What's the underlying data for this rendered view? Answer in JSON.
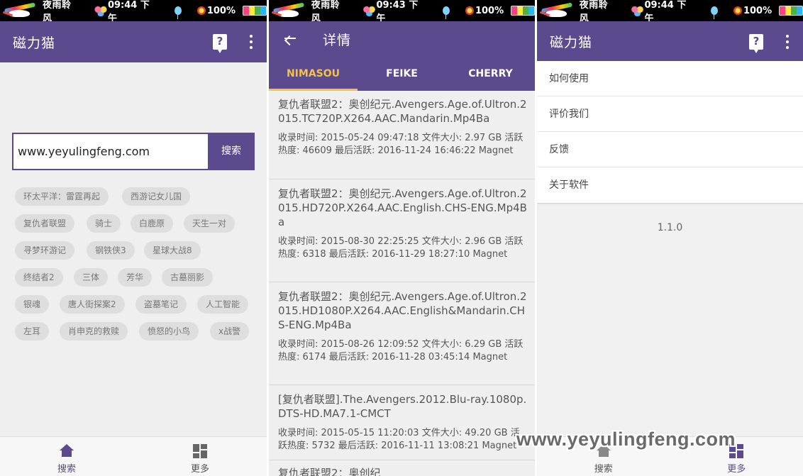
{
  "status_bars": [
    {
      "name": "夜雨聆风",
      "time": "09:44 下午",
      "battery": "100%"
    },
    {
      "name": "夜雨聆风",
      "time": "09:43 下午",
      "battery": "100%"
    },
    {
      "name": "夜雨聆风",
      "time": "09:44 下午",
      "battery": "100%"
    }
  ],
  "search_screen": {
    "title": "磁力猫",
    "input_value": "www.yeyulingfeng.com",
    "search_button": "搜索",
    "tags": [
      [
        "环太平洋：雷霆再起",
        "西游记女儿国"
      ],
      [
        "复仇者联盟",
        "骑士",
        "白鹿原",
        "天生一对"
      ],
      [
        "寻梦环游记",
        "钢铁侠3",
        "星球大战8"
      ],
      [
        "终结者2",
        "三体",
        "芳华",
        "古墓丽影"
      ],
      [
        "银魂",
        "唐人街探案2",
        "盗墓笔记",
        "人工智能"
      ],
      [
        "左耳",
        "肖申克的救赎",
        "愤怒的小鸟",
        "x战警"
      ]
    ],
    "bottom_nav": {
      "search": "搜索",
      "more": "更多"
    }
  },
  "detail_screen": {
    "title": "详情",
    "tabs": [
      "NIMASOU",
      "FEIKE",
      "CHERRY"
    ],
    "results": [
      {
        "title": "复仇者联盟2：奥创纪元.Avengers.Age.of.Ultron.2015.TC720P.X264.AAC.Mandarin.Mp4Ba",
        "meta": "收录时间: 2015-05-24 09:47:18 文件大小: 2.97 GB 活跃热度: 46609 最后活跃: 2016-11-24 16:46:22 Magnet"
      },
      {
        "title": "复仇者联盟2：奥创纪元.Avengers.Age.of.Ultron.2015.HD720P.X264.AAC.English.CHS-ENG.Mp4Ba",
        "meta": "收录时间: 2015-08-30 22:25:25 文件大小: 2.96 GB 活跃热度: 6318 最后活跃: 2016-11-29 18:27:10 Magnet"
      },
      {
        "title": "复仇者联盟2：奥创纪元.Avengers.Age.of.Ultron.2015.HD1080P.X264.AAC.English&Mandarin.CHS-ENG.Mp4Ba",
        "meta": "收录时间: 2015-08-26 12:09:52 文件大小: 6.29 GB 活跃热度: 6174 最后活跃: 2016-11-28 03:45:14 Magnet"
      },
      {
        "title": "[复仇者联盟].The.Avengers.2012.Blu-ray.1080p.DTS-HD.MA7.1-CMCT",
        "meta": "收录时间: 2015-05-15 11:20:03 文件大小: 49.20 GB 活跃热度: 5732 最后活跃: 2016-11-11 13:08:21 Magnet"
      },
      {
        "title": "复仇者联盟2：奥创纪",
        "meta": ""
      }
    ]
  },
  "more_screen": {
    "title": "磁力猫",
    "menu": [
      "如何使用",
      "评价我们",
      "反馈",
      "关于软件"
    ],
    "version": "1.1.0",
    "bottom_nav": {
      "search": "搜索",
      "more": "更多"
    }
  },
  "watermark": "www.yeyulingfeng.com",
  "colors": {
    "primary": "#5c4a8e",
    "tab_indicator": "#f5c242",
    "background": "#efefef"
  },
  "icons": [
    "help-icon",
    "more-vert-icon",
    "back-arrow-icon",
    "home-icon",
    "dashboard-icon"
  ]
}
